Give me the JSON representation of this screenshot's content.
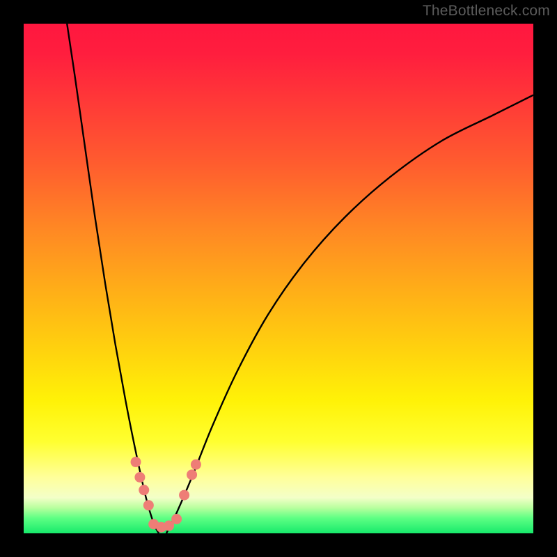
{
  "watermark": {
    "text": "TheBottleneck.com"
  },
  "colors": {
    "gradient_top": "#ff173f",
    "gradient_mid": "#ffd20e",
    "gradient_bottom": "#17ea6b",
    "curve_stroke": "#000000",
    "marker_fill": "#ee7d76",
    "frame": "#000000"
  },
  "chart_data": {
    "type": "line",
    "title": "",
    "xlabel": "",
    "ylabel": "",
    "xlim": [
      0,
      100
    ],
    "ylim": [
      0,
      100
    ],
    "grid": false,
    "note": "Two branches of a bottleneck-style curve meeting near x≈26 at y≈0. Values estimated from pixel positions; y=0 at bottom, y=100 at top.",
    "series": [
      {
        "name": "left-branch",
        "x": [
          8.5,
          10,
          12,
          14,
          16,
          18,
          20,
          22,
          24,
          25.5,
          26.5
        ],
        "y": [
          100,
          90,
          76,
          62,
          49,
          37,
          26,
          16,
          7,
          2,
          0
        ]
      },
      {
        "name": "right-branch",
        "x": [
          28,
          30,
          33,
          37,
          42,
          48,
          55,
          63,
          72,
          82,
          92,
          100
        ],
        "y": [
          0,
          4,
          11,
          21,
          32,
          43,
          53,
          62,
          70,
          77,
          82,
          86
        ]
      }
    ],
    "markers": [
      {
        "name": "left-branch-marker",
        "x": 22.0,
        "y": 14.0
      },
      {
        "name": "left-branch-marker",
        "x": 22.8,
        "y": 11.0
      },
      {
        "name": "left-branch-marker",
        "x": 23.6,
        "y": 8.5
      },
      {
        "name": "left-branch-marker",
        "x": 24.5,
        "y": 5.5
      },
      {
        "name": "valley-marker",
        "x": 25.5,
        "y": 1.8
      },
      {
        "name": "valley-marker",
        "x": 27.0,
        "y": 1.2
      },
      {
        "name": "valley-marker",
        "x": 28.5,
        "y": 1.5
      },
      {
        "name": "valley-marker",
        "x": 30.0,
        "y": 2.8
      },
      {
        "name": "right-branch-marker",
        "x": 31.5,
        "y": 7.5
      },
      {
        "name": "right-branch-marker",
        "x": 33.0,
        "y": 11.5
      },
      {
        "name": "right-branch-marker",
        "x": 33.8,
        "y": 13.5
      }
    ]
  }
}
